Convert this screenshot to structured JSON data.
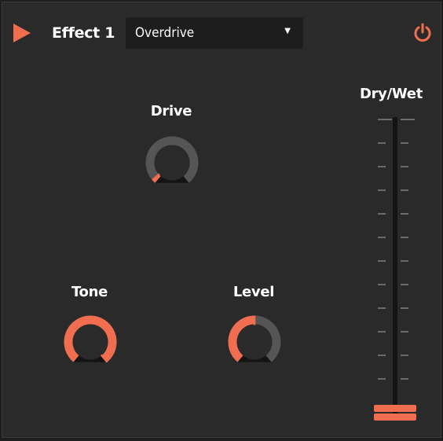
{
  "header": {
    "play_icon": "play-triangle-icon",
    "title": "Effect 1",
    "effect_type": {
      "selected": "Overdrive",
      "caret": "▼"
    },
    "power_icon": "power-icon"
  },
  "knobs": {
    "drive": {
      "label": "Drive",
      "value": 0.03
    },
    "tone": {
      "label": "Tone",
      "value": 1.0
    },
    "level": {
      "label": "Level",
      "value": 0.5
    }
  },
  "dry_wet": {
    "label": "Dry/Wet",
    "value": 0.0,
    "tick_count": 12
  },
  "colors": {
    "accent": "#f06e4f",
    "panel_bg": "#2a2a2a",
    "knob_track": "#555555",
    "knob_center": "#2a2a2a",
    "dropdown_bg": "#1d1d1d",
    "text": "#ffffff"
  }
}
